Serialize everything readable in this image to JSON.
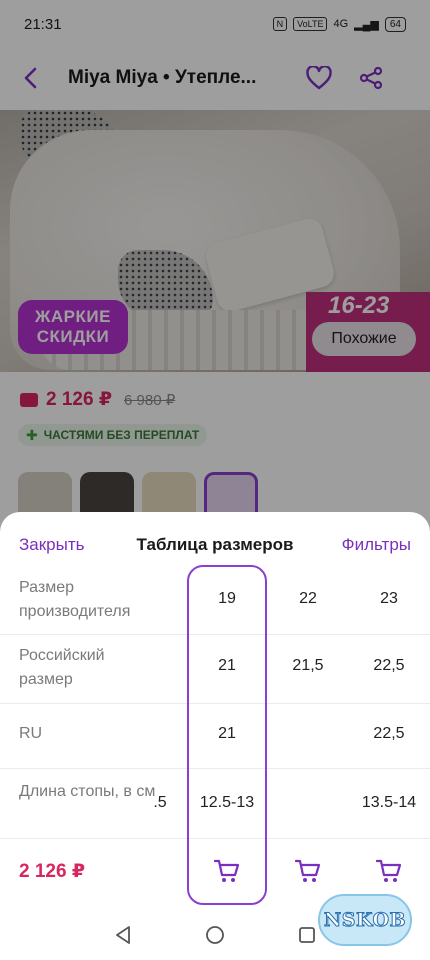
{
  "status_bar": {
    "time": "21:31",
    "nfc": "N",
    "volte": "VoLTE",
    "network": "4G",
    "battery": "64"
  },
  "header": {
    "title": "Miya Miya • Утепле..."
  },
  "product": {
    "promo_badge": "ЖАРКИЕ СКИДКИ",
    "size_range_banner": "16-23",
    "similar_button": "Похожие",
    "price": "2 126 ₽",
    "old_price": "6 980 ₽",
    "installments": "ЧАСТЯМИ БЕЗ ПЕРЕПЛАТ"
  },
  "size_sheet": {
    "close_label": "Закрыть",
    "title": "Таблица размеров",
    "filters_label": "Фильтры",
    "rows": [
      {
        "label": "Размер производителя",
        "cells": [
          "",
          "19",
          "22",
          "23"
        ]
      },
      {
        "label": "Российский размер",
        "cells": [
          "",
          "21",
          "21,5",
          "22,5"
        ]
      },
      {
        "label": "RU",
        "cells": [
          "",
          "21",
          "",
          "22,5"
        ]
      },
      {
        "label": "Длина стопы, в см",
        "cells": [
          ".5",
          "12.5-13",
          "",
          "13.5-14"
        ]
      }
    ],
    "price": "2 126 ₽"
  },
  "watermark": "NSKOB",
  "colors": {
    "accent": "#7b2fbe",
    "price": "#d8265f",
    "highlight_border": "#8a3fd1"
  }
}
